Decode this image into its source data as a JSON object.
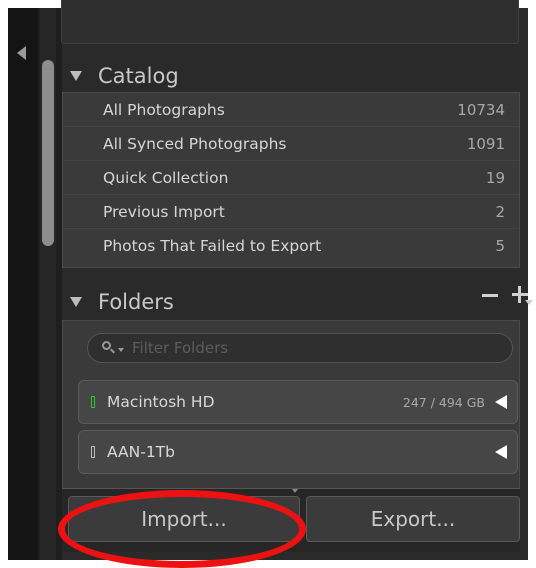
{
  "catalog": {
    "title": "Catalog",
    "items": [
      {
        "label": "All Photographs",
        "count": "10734"
      },
      {
        "label": "All Synced Photographs",
        "count": "1091"
      },
      {
        "label": "Quick Collection",
        "count": "19"
      },
      {
        "label": "Previous Import",
        "count": "2"
      },
      {
        "label": "Photos That Failed to Export",
        "count": "5"
      }
    ]
  },
  "folders": {
    "title": "Folders",
    "search_placeholder": "Filter Folders",
    "volumes": [
      {
        "name": "Macintosh HD",
        "size": "247 / 494 GB",
        "indicator_color": "#22cc22"
      },
      {
        "name": "AAN-1Tb",
        "size": "",
        "indicator_color": "#bbbbbb"
      }
    ]
  },
  "buttons": {
    "import_label": "Import...",
    "export_label": "Export..."
  },
  "colors": {
    "panel_bg": "#2a2a2a",
    "highlight": "#ee1111"
  }
}
